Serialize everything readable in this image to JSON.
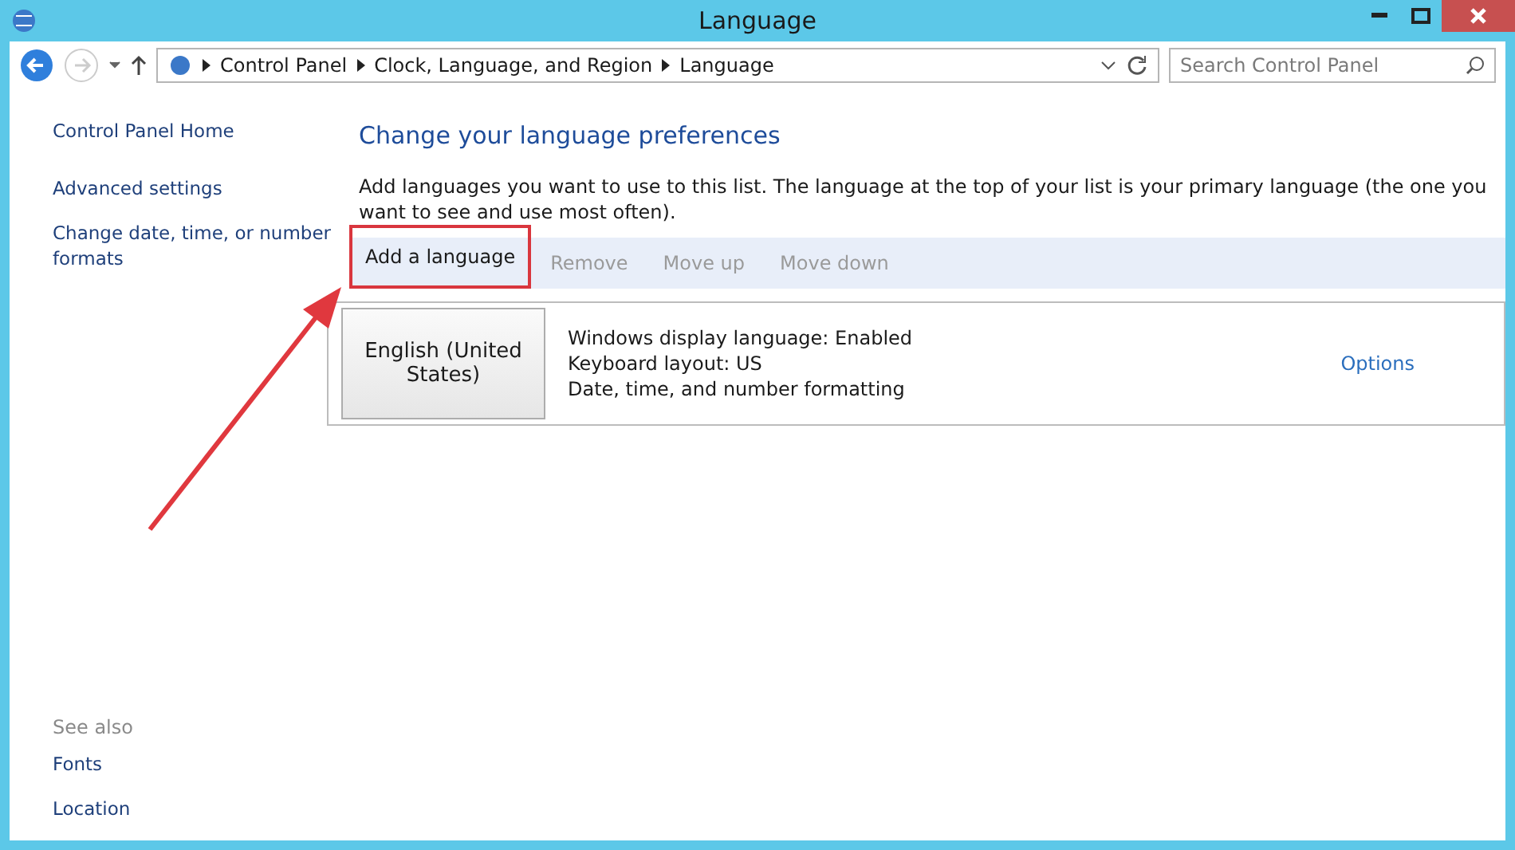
{
  "window": {
    "title": "Language"
  },
  "address": {
    "crumbs": [
      "Control Panel",
      "Clock, Language, and Region",
      "Language"
    ]
  },
  "search": {
    "placeholder": "Search Control Panel"
  },
  "sidebar": {
    "items": [
      "Control Panel Home",
      "Advanced settings",
      "Change date, time, or number formats"
    ],
    "see_also": {
      "heading": "See also",
      "links": [
        "Fonts",
        "Location"
      ]
    }
  },
  "content": {
    "heading": "Change your language preferences",
    "description": "Add languages you want to use to this list. The language at the top of your list is your primary language (the one you want to see and use most often).",
    "toolbar": [
      {
        "label": "Add a language",
        "disabled": false,
        "highlighted": true
      },
      {
        "label": "Remove",
        "disabled": true,
        "highlighted": false
      },
      {
        "label": "Move up",
        "disabled": true,
        "highlighted": false
      },
      {
        "label": "Move down",
        "disabled": true,
        "highlighted": false
      }
    ],
    "languages": [
      {
        "name": "English (United States)",
        "details": [
          "Windows display language: Enabled",
          "Keyboard layout: US",
          "Date, time, and number formatting"
        ],
        "options": "Options"
      }
    ]
  }
}
